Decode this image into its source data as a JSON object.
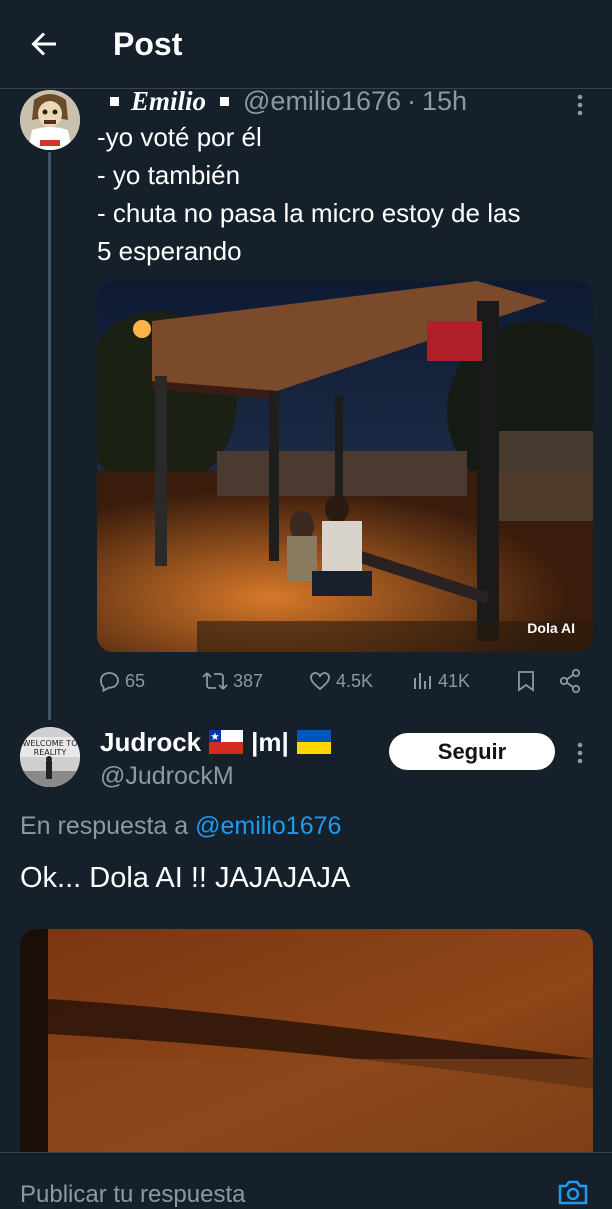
{
  "header": {
    "title": "Post"
  },
  "tweet1": {
    "display_name": "Emilio",
    "handle": "@emilio1676",
    "separator": "·",
    "time": "15h",
    "lines": [
      "-yo voté por él",
      "- yo también",
      "- chuta no pasa la micro estoy de las",
      "5 esperando"
    ],
    "media_watermark": "Dola AI",
    "actions": {
      "replies": "65",
      "reposts": "387",
      "likes": "4.5K",
      "views": "41K"
    }
  },
  "tweet2": {
    "display_name": "Judrock",
    "name_suffix": "|m|",
    "handle": "@JudrockM",
    "follow_label": "Seguir",
    "reply_to_prefix": "En respuesta a",
    "reply_to_handle": "@emilio1676",
    "text": "Ok... Dola AI !! JAJAJAJA"
  },
  "composer": {
    "placeholder": "Publicar tu respuesta"
  },
  "colors": {
    "background": "#15202b",
    "secondary_text": "#8b98a5",
    "link": "#1d9bf0",
    "divider": "#38444d"
  }
}
